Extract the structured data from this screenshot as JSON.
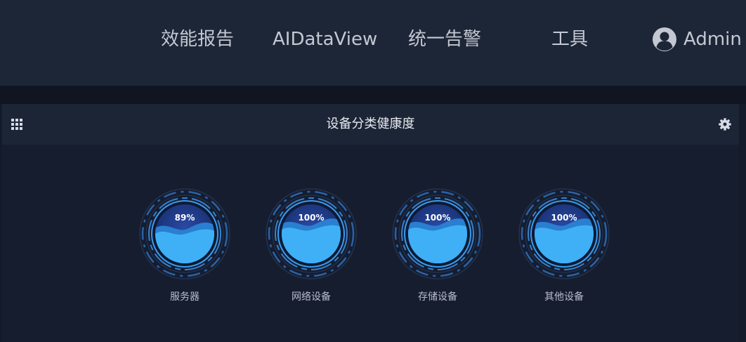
{
  "nav": {
    "items": [
      {
        "label": "效能报告"
      },
      {
        "label": "AIDataView"
      },
      {
        "label": "统一告警"
      },
      {
        "label": "工具"
      }
    ],
    "user": {
      "name": "Admin",
      "icon": "user-circle-icon"
    }
  },
  "panel": {
    "title": "设备分类健康度",
    "left_icon": "grid-icon",
    "right_icon": "gear-icon"
  },
  "gauges": [
    {
      "percent_text": "89%",
      "value": 89,
      "label": "服务器"
    },
    {
      "percent_text": "100%",
      "value": 100,
      "label": "网络设备"
    },
    {
      "percent_text": "100%",
      "value": 100,
      "label": "存储设备"
    },
    {
      "percent_text": "100%",
      "value": 100,
      "label": "其他设备"
    }
  ],
  "colors": {
    "background": "#141a29",
    "topbar": "#1d2637",
    "panel": "#161d2e",
    "panel_header": "#1c2536",
    "wave_light": "#3fb0f5",
    "wave_mid": "#2a7fd0",
    "gauge_inner": "#1d3b86",
    "ring": "#2f6fb8"
  }
}
